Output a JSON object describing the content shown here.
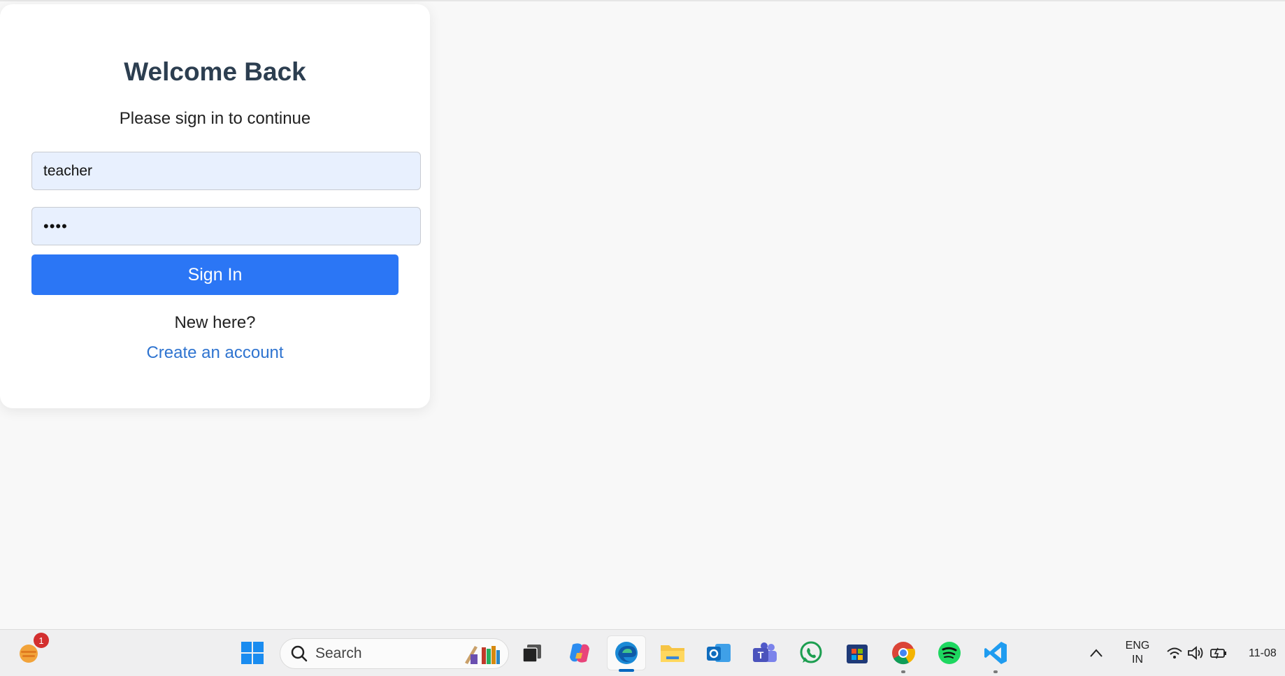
{
  "login": {
    "title": "Welcome Back",
    "subtitle": "Please sign in to continue",
    "username_value": "teacher",
    "password_value": "••••",
    "signin_label": "Sign In",
    "new_here": "New here?",
    "create_account_label": "Create an account"
  },
  "colors": {
    "accent": "#2b76f5",
    "link": "#2f74d0",
    "title": "#2c3e50",
    "input_bg": "#e8f0fe"
  },
  "taskbar": {
    "widget_badge": "1",
    "search_label": "Search",
    "apps": [
      {
        "name": "start-icon"
      },
      {
        "name": "task-view-icon"
      },
      {
        "name": "copilot-icon"
      },
      {
        "name": "edge-icon",
        "active": true
      },
      {
        "name": "file-explorer-icon"
      },
      {
        "name": "outlook-icon"
      },
      {
        "name": "teams-icon"
      },
      {
        "name": "whatsapp-icon"
      },
      {
        "name": "microsoft-store-icon"
      },
      {
        "name": "chrome-icon"
      },
      {
        "name": "spotify-icon"
      },
      {
        "name": "vscode-icon"
      }
    ],
    "language_line1": "ENG",
    "language_line2": "IN",
    "clock": "11-08"
  }
}
